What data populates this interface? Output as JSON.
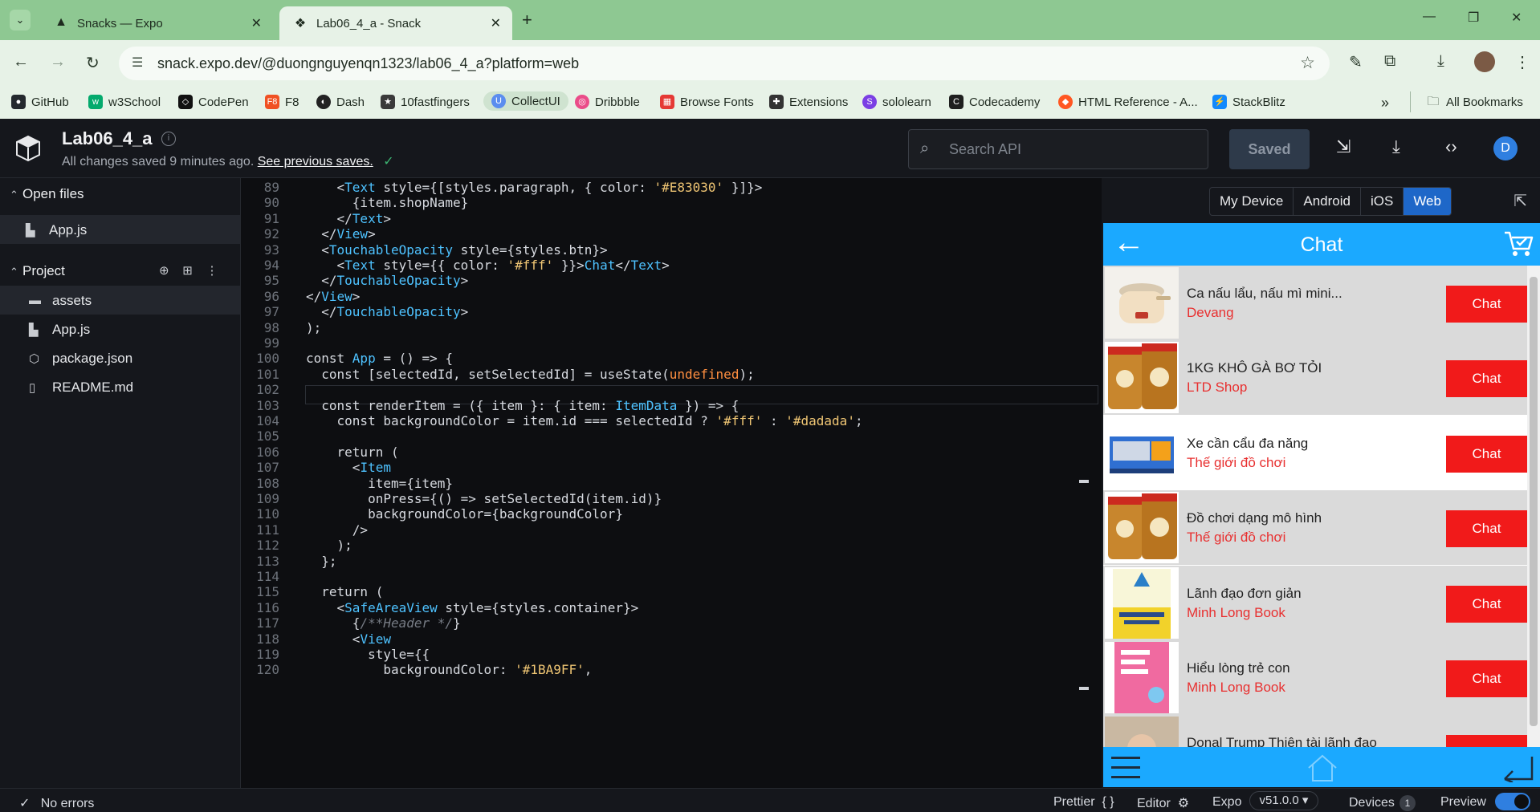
{
  "browser": {
    "tabs": [
      {
        "title": "Snacks — Expo",
        "active": false
      },
      {
        "title": "Lab06_4_a - Snack",
        "active": true
      }
    ],
    "url": "snack.expo.dev/@duongnguyenqn1323/lab06_4_a?platform=web",
    "bookmarks": [
      {
        "label": "GitHub",
        "color": "#24292e"
      },
      {
        "label": "w3School",
        "color": "#04aa6d"
      },
      {
        "label": "CodePen",
        "color": "#111111"
      },
      {
        "label": "F8",
        "color": "#f05123"
      },
      {
        "label": "Dash",
        "color": "#222222"
      },
      {
        "label": "10fastfingers",
        "color": "#3a3a3a"
      },
      {
        "label": "CollectUI",
        "color": "#5b8def"
      },
      {
        "label": "Dribbble",
        "color": "#ea4c89"
      },
      {
        "label": "Browse Fonts",
        "color": "#e53935"
      },
      {
        "label": "Extensions",
        "color": "#333333"
      },
      {
        "label": "sololearn",
        "color": "#7b3fe4"
      },
      {
        "label": "Codecademy",
        "color": "#1f1f1f"
      },
      {
        "label": "HTML Reference - A...",
        "color": "#ff5722"
      },
      {
        "label": "StackBlitz",
        "color": "#1389fd"
      }
    ],
    "all_bookmarks": "All Bookmarks"
  },
  "snack": {
    "title": "Lab06_4_a",
    "saved_text": "All changes saved 9 minutes ago.",
    "see_previous": "See previous saves.",
    "search_placeholder": "Search API",
    "saved_button": "Saved",
    "user_initial": "D"
  },
  "sidebar": {
    "open_files": "Open files",
    "open_file_items": [
      "App.js"
    ],
    "project": "Project",
    "project_items": [
      "assets",
      "App.js",
      "package.json",
      "README.md"
    ]
  },
  "editor": {
    "lines": [
      {
        "n": "89",
        "html": "    &lt;<span class='t'>Text</span> style={[styles.paragraph, { color: <span class='s'>'#E83030'</span> }]}&gt;"
      },
      {
        "n": "90",
        "html": "      {item.shopName}"
      },
      {
        "n": "91",
        "html": "    &lt;/<span class='t'>Text</span>&gt;"
      },
      {
        "n": "92",
        "html": "  &lt;/<span class='t'>View</span>&gt;"
      },
      {
        "n": "93",
        "html": "  &lt;<span class='t'>TouchableOpacity</span> style={styles.btn}&gt;"
      },
      {
        "n": "94",
        "html": "    &lt;<span class='t'>Text</span> style={{ color: <span class='s'>'#fff'</span> }}&gt;<span class='t'>Chat</span>&lt;/<span class='t'>Text</span>&gt;"
      },
      {
        "n": "95",
        "html": "  &lt;/<span class='t'>TouchableOpacity</span>&gt;"
      },
      {
        "n": "96",
        "html": "&lt;/<span class='t'>View</span>&gt;"
      },
      {
        "n": "97",
        "html": "  &lt;/<span class='t'>TouchableOpacity</span>&gt;"
      },
      {
        "n": "98",
        "html": ");"
      },
      {
        "n": "99",
        "html": ""
      },
      {
        "n": "100",
        "html": "const <span class='t'>App</span> = () =&gt; {"
      },
      {
        "n": "101",
        "html": "  const [selectedId, setSelectedId] = useState(<span class='u'>undefined</span>);"
      },
      {
        "n": "102",
        "html": ""
      },
      {
        "n": "103",
        "html": "  const renderItem = ({ item }: { item: <span class='t'>ItemData</span> }) =&gt; {"
      },
      {
        "n": "104",
        "html": "    const backgroundColor = item.id === selectedId ? <span class='s'>'#fff'</span> : <span class='s'>'#dadada'</span>;"
      },
      {
        "n": "105",
        "html": ""
      },
      {
        "n": "106",
        "html": "    return ("
      },
      {
        "n": "107",
        "html": "      &lt;<span class='t'>Item</span>"
      },
      {
        "n": "108",
        "html": "        item={item}"
      },
      {
        "n": "109",
        "html": "        onPress={() =&gt; setSelectedId(item.id)}"
      },
      {
        "n": "110",
        "html": "        backgroundColor={backgroundColor}"
      },
      {
        "n": "111",
        "html": "      /&gt;"
      },
      {
        "n": "112",
        "html": "    );"
      },
      {
        "n": "113",
        "html": "  };"
      },
      {
        "n": "114",
        "html": ""
      },
      {
        "n": "115",
        "html": "  return ("
      },
      {
        "n": "116",
        "html": "    &lt;<span class='t'>SafeAreaView</span> style={styles.container}&gt;"
      },
      {
        "n": "117",
        "html": "      {<span class='cm'>/**Header */</span>}"
      },
      {
        "n": "118",
        "html": "      &lt;<span class='t'>View</span>"
      },
      {
        "n": "119",
        "html": "        style={{"
      },
      {
        "n": "120",
        "html": "          backgroundColor: <span class='s'>'#1BA9FF'</span>,"
      }
    ]
  },
  "preview": {
    "platforms": [
      "My Device",
      "Android",
      "iOS",
      "Web"
    ],
    "active_platform": "Web",
    "header_title": "Chat",
    "header_color": "#1BA9FF",
    "items": [
      {
        "name": "Ca nấu lẩu, nấu mì mini...",
        "shop": "Devang",
        "button": "Chat",
        "bg": "#dadada",
        "thumb": "cooker"
      },
      {
        "name": "1KG KHÔ GÀ BƠ TỎI",
        "shop": "LTD Shop",
        "button": "Chat",
        "bg": "#dadada",
        "thumb": "jar"
      },
      {
        "name": "Xe cần cẩu đa năng",
        "shop": "Thế giới đồ chơi",
        "button": "Chat",
        "bg": "#ffffff",
        "thumb": "truck"
      },
      {
        "name": "Đồ chơi dạng mô hình",
        "shop": "Thế giới đồ chơi",
        "button": "Chat",
        "bg": "#dadada",
        "thumb": "jar"
      },
      {
        "name": "Lãnh đạo đơn giản",
        "shop": "Minh Long Book",
        "button": "Chat",
        "bg": "#dadada",
        "thumb": "book-yellow"
      },
      {
        "name": "Hiểu lòng trẻ con",
        "shop": "Minh Long Book",
        "button": "Chat",
        "bg": "#dadada",
        "thumb": "book-pink"
      },
      {
        "name": "Donal Trump Thiên tài lãnh đạo",
        "shop": "",
        "button": "Chat",
        "bg": "#dadada",
        "thumb": "person"
      }
    ]
  },
  "statusbar": {
    "errors": "No errors",
    "prettier": "Prettier",
    "editor": "Editor",
    "expo": "Expo",
    "version": "v51.0.0",
    "devices": "Devices",
    "devices_count": "1",
    "preview": "Preview"
  }
}
